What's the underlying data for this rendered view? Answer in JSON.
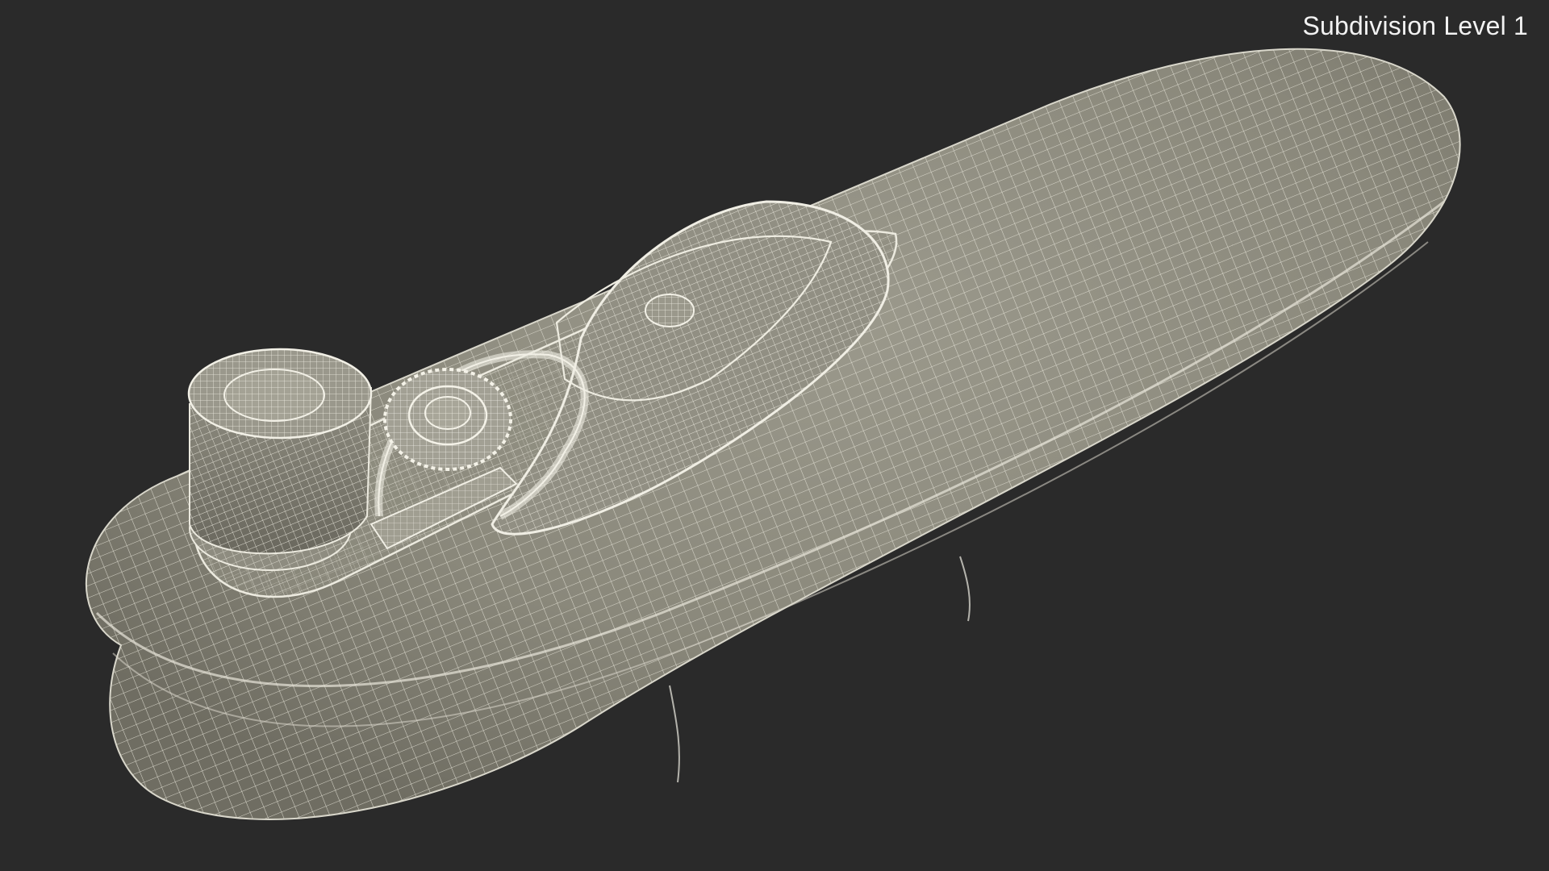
{
  "viewport": {
    "overlay_label": "Subdivision Level 1",
    "background_color": "#2a2a2a",
    "mesh_fill_color": "#8c8a7e",
    "wire_color": "#e4e2d6"
  },
  "model": {
    "render_mode": "wireframe-on-shaded",
    "parts": [
      "body-shell",
      "top-dome-cover",
      "cylinder-knob",
      "gear-dial",
      "dial-rail",
      "center-button"
    ]
  }
}
